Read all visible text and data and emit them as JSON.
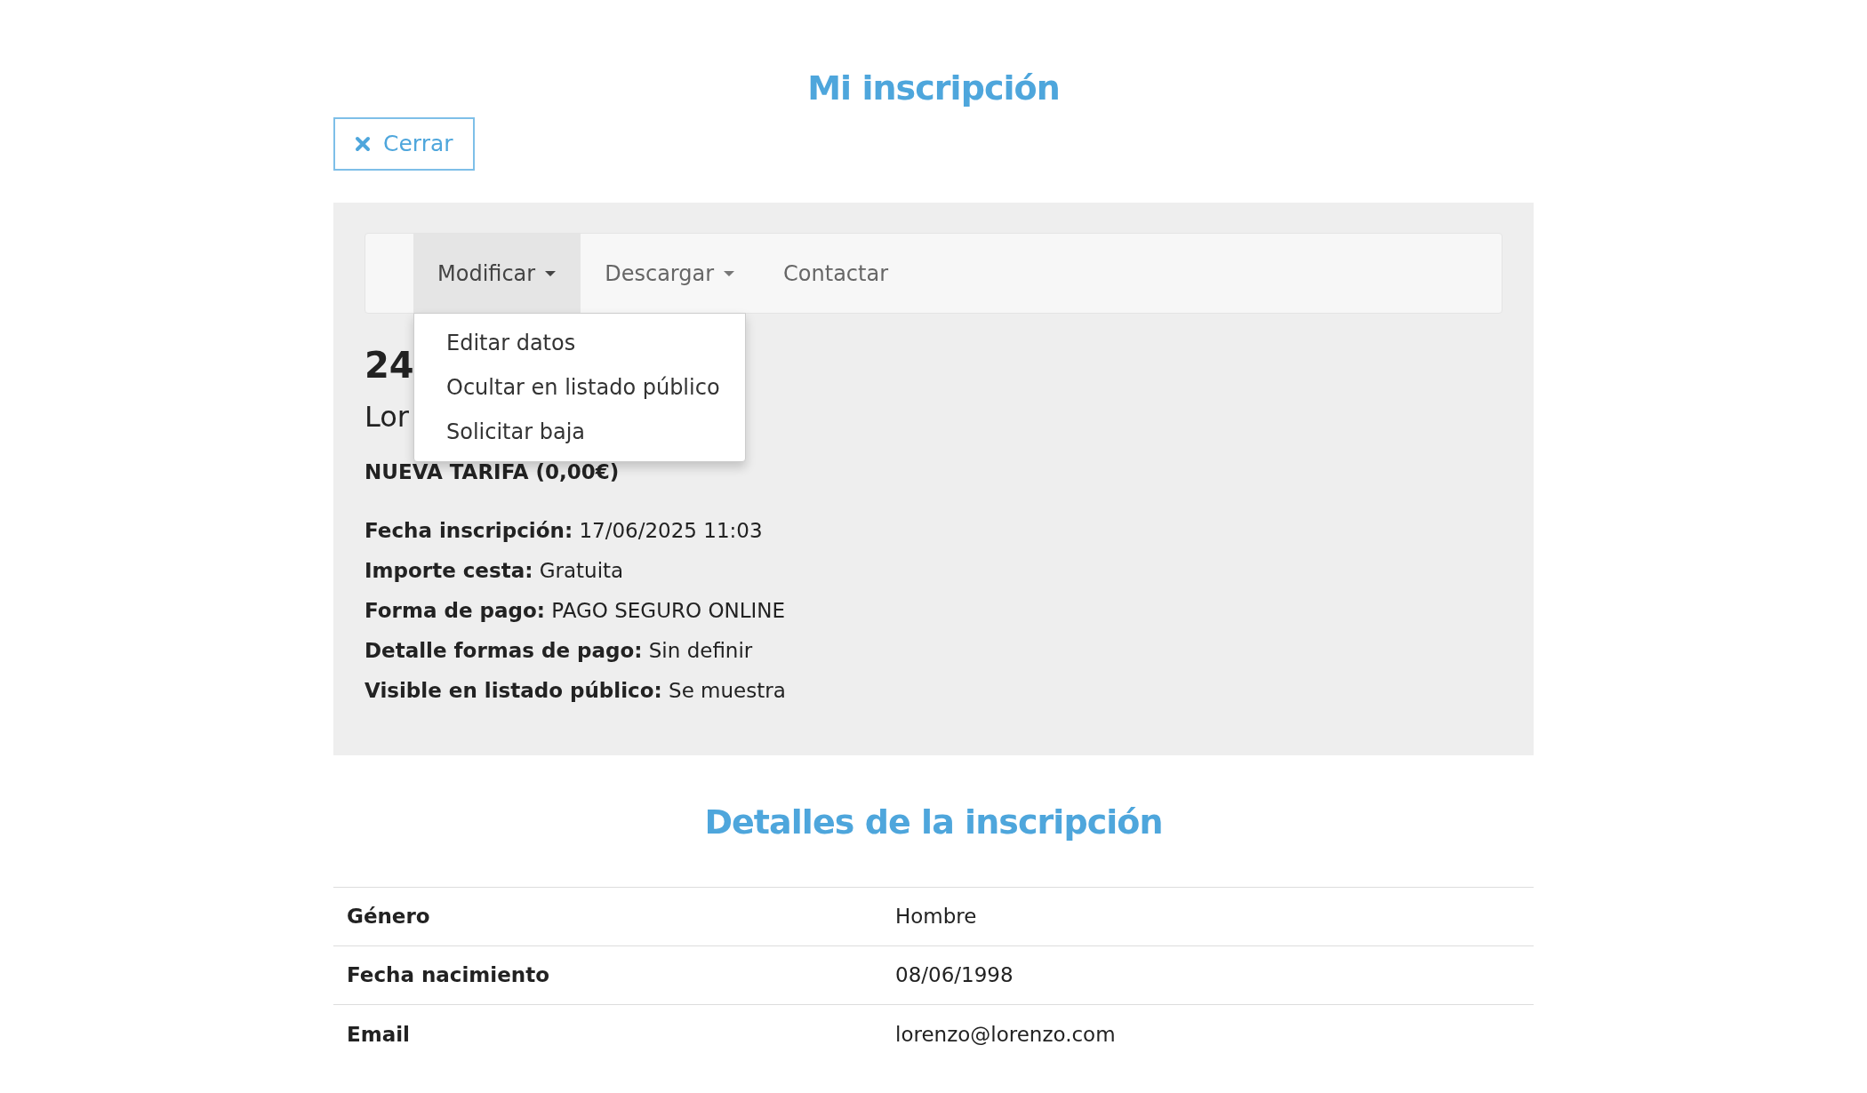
{
  "page_title": "Mi inscripción",
  "close_button": {
    "label": "Cerrar"
  },
  "menu": [
    {
      "label": "Modificar",
      "dropdown": true,
      "expanded": true,
      "items": [
        "Editar datos",
        "Ocultar en listado público",
        "Solicitar baja"
      ]
    },
    {
      "label": "Descargar",
      "dropdown": true,
      "expanded": false
    },
    {
      "label": "Contactar",
      "dropdown": false,
      "expanded": false
    }
  ],
  "registration": {
    "code": "24",
    "name": "Lor",
    "rate": "NUEVA TARIFA (0,00€)",
    "fields": [
      {
        "label": "Fecha inscripción:",
        "value": "17/06/2025 11:03"
      },
      {
        "label": "Importe cesta:",
        "value": "Gratuita"
      },
      {
        "label": "Forma de pago:",
        "value": "PAGO SEGURO ONLINE"
      },
      {
        "label": "Detalle formas de pago:",
        "value": "Sin definir"
      },
      {
        "label": "Visible en listado público:",
        "value": "Se muestra"
      }
    ]
  },
  "details_title": "Detalles de la inscripción",
  "details": [
    {
      "label": "Género",
      "value": "Hombre"
    },
    {
      "label": "Fecha nacimiento",
      "value": "08/06/1998"
    },
    {
      "label": "Email",
      "value": "lorenzo@lorenzo.com"
    }
  ]
}
